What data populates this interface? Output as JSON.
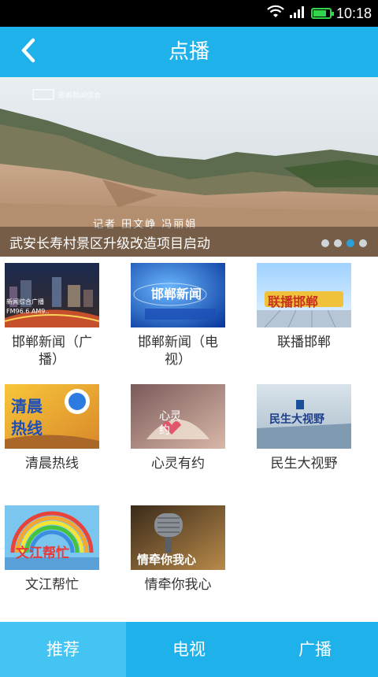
{
  "status_bar": {
    "time": "10:18",
    "battery_level": 0.8
  },
  "header": {
    "title": "点播"
  },
  "banner": {
    "caption": "武安长寿村景区升级改造项目启动",
    "reporter_text": "记者 田文峥 冯丽娟",
    "channel_logo_text": "邯郸新闻综合",
    "page_count": 4,
    "active_page": 3
  },
  "programs": [
    {
      "title": "邯郸新闻（广\n播）",
      "thumb_text": "新闻综合广播\nFM96.6 AM9..",
      "icon": "city-night"
    },
    {
      "title": "邯郸新闻（电\n视）",
      "thumb_text": "邯郸新闻",
      "icon": "news-studio"
    },
    {
      "title": "联播邯郸",
      "thumb_text": "联播邯郸",
      "icon": "news-lianbo"
    },
    {
      "title": "清晨热线",
      "thumb_text": "清晨\n热线",
      "icon": "morning-hotline"
    },
    {
      "title": "心灵有约",
      "thumb_text": "心灵\n约",
      "icon": "heart-book"
    },
    {
      "title": "民生大视野",
      "thumb_text": "民生大视野",
      "icon": "people-vision"
    },
    {
      "title": "文江帮忙",
      "thumb_text": "文江帮忙",
      "icon": "rainbow"
    },
    {
      "title": "情牵你我心",
      "thumb_text": "情牵你我心",
      "icon": "microphone"
    }
  ],
  "tabs": [
    {
      "label": "推荐",
      "active": true
    },
    {
      "label": "电视",
      "active": false
    },
    {
      "label": "广播",
      "active": false
    }
  ],
  "colors": {
    "header": "#1fb1ea",
    "tab_active": "#43c4f3",
    "dot_active": "#2b9fd8"
  }
}
